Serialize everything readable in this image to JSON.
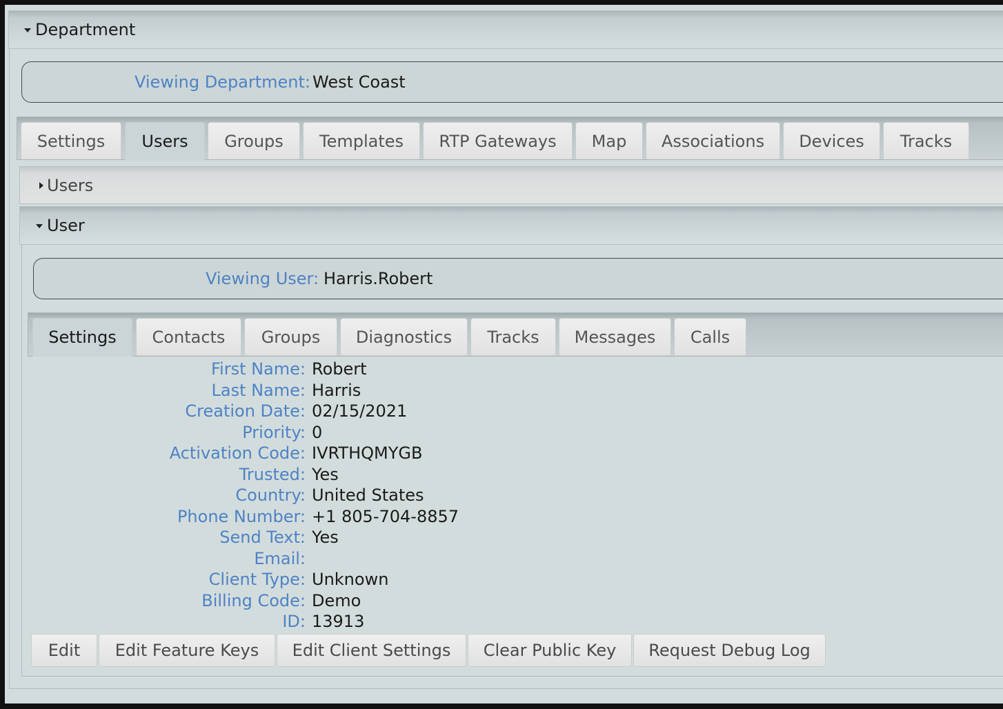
{
  "department": {
    "header": "Department",
    "viewing_label": "Viewing Department:",
    "viewing_value": "West Coast",
    "tabs": [
      "Settings",
      "Users",
      "Groups",
      "Templates",
      "RTP Gateways",
      "Map",
      "Associations",
      "Devices",
      "Tracks"
    ],
    "active_tab": "Users"
  },
  "users_section": {
    "header": "Users"
  },
  "user_section": {
    "header": "User",
    "viewing_label": "Viewing User:",
    "viewing_value": "Harris.Robert",
    "tabs": [
      "Settings",
      "Contacts",
      "Groups",
      "Diagnostics",
      "Tracks",
      "Messages",
      "Calls"
    ],
    "active_tab": "Settings"
  },
  "fields": [
    {
      "label": "First Name:",
      "value": "Robert"
    },
    {
      "label": "Last Name:",
      "value": "Harris"
    },
    {
      "label": "Creation Date:",
      "value": "02/15/2021"
    },
    {
      "label": "Priority:",
      "value": "0"
    },
    {
      "label": "Activation Code:",
      "value": "IVRTHQMYGB"
    },
    {
      "label": "Trusted:",
      "value": "Yes"
    },
    {
      "label": "Country:",
      "value": "United States"
    },
    {
      "label": "Phone Number:",
      "value": "+1 805-704-8857"
    },
    {
      "label": "Send Text:",
      "value": "Yes"
    },
    {
      "label": "Email:",
      "value": ""
    },
    {
      "label": "Client Type:",
      "value": "Unknown"
    },
    {
      "label": "Billing Code:",
      "value": "Demo"
    },
    {
      "label": "ID:",
      "value": "13913"
    }
  ],
  "actions": [
    "Edit",
    "Edit Feature Keys",
    "Edit Client Settings",
    "Clear Public Key",
    "Request Debug Log"
  ],
  "icons": {
    "expanded": "triangle-down-icon",
    "collapsed": "triangle-right-icon"
  },
  "colors": {
    "label_blue": "#4d83c4",
    "background": "#d3dcdd",
    "active_tab": "#cbd4d6"
  }
}
